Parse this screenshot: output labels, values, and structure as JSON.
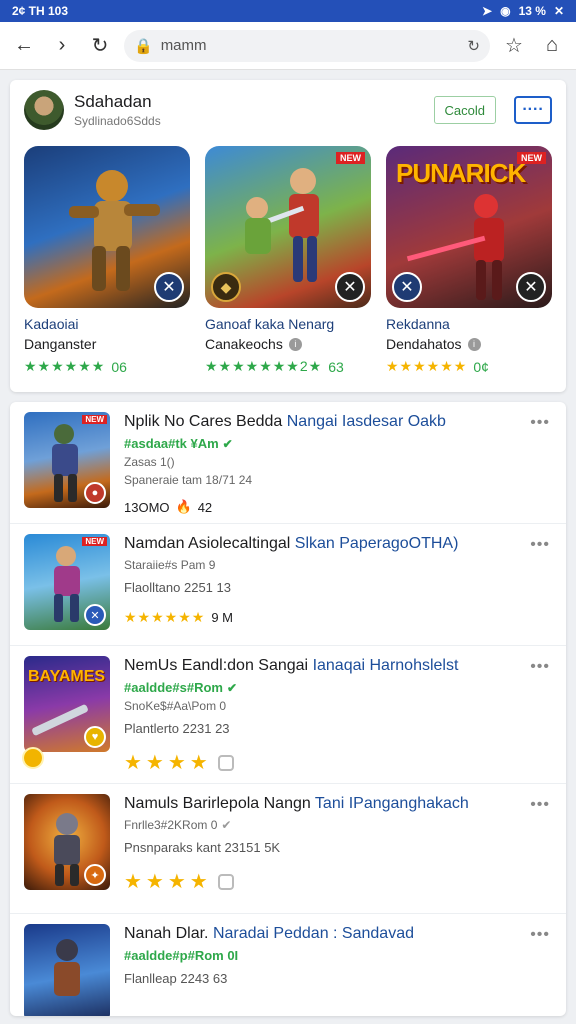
{
  "status": {
    "time": "2¢ TH 103",
    "right": "13 %"
  },
  "toolbar": {
    "url": "mamm"
  },
  "developer": {
    "name": "Sdahadan",
    "subtitle": "Sydlinado6Sdds",
    "cancel_label": "Cacold",
    "more_label": "····"
  },
  "featured": [
    {
      "title": "Kadaoiai",
      "developer": "Danganster",
      "stars": "★★★★★★",
      "rating": "06"
    },
    {
      "title": "Ganoaf kaka Nenarg",
      "developer": "Canakeochs",
      "stars": "★★★★★★★2★",
      "rating": "63"
    },
    {
      "title": "Rekdanna",
      "developer": "Dendahatos",
      "stars": "★★★★★★",
      "rating": "0¢",
      "poster": "PUNARICK"
    }
  ],
  "list": [
    {
      "title_black": "Nplik No Cares Bedda",
      "title_blue": "Nangai Iasdesar Oakb",
      "green": "#asdaa#tk ¥Am",
      "gray": "Zasas 1()",
      "meta1": "Spaneraie tam  18/71 24",
      "rating_text": "13OMO",
      "rating_extra": "42",
      "tag": "NEW"
    },
    {
      "title_black": "Namdan Asiolecaltingal",
      "title_blue": "Slkan PaperagoOTHA)",
      "green": "",
      "gray": "Staraiie#s Pam 9",
      "meta1": "Flaolltano  2251 13",
      "stars": "★★★★★★",
      "rating_text": "9 M",
      "tag": "NEW"
    },
    {
      "title_black": "NemUs Eandl:don Sangai",
      "title_blue": "Ianaqai Harnohslelst",
      "green": "#aaldde#s#Rom",
      "gray": "SnoKe$#Aa\\Pom 0",
      "meta1": "Plantlerto 2231 23",
      "stars": "★★★★",
      "poster": "BAYAMES"
    },
    {
      "title_black": "Namuls Barirlepola Nangn",
      "title_blue": "Tani IPanganghakach",
      "green": "",
      "gray": "Fnrlle3#2KRom 0",
      "meta1": "Pnsnparaks kant  23151 5K",
      "stars": "★★★★"
    },
    {
      "title_black": "Nanah Dlar.",
      "title_blue": "Naradai Peddan : Sandavad",
      "green": "#aaldde#p#Rom 0I",
      "gray": "",
      "meta1": "Flanlleap  2243 63"
    }
  ]
}
